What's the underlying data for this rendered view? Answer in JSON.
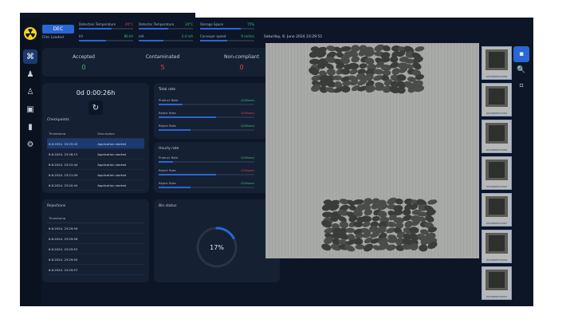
{
  "header": {
    "dec_label": "DEC",
    "film_status": "Film Loaded",
    "metrics": [
      {
        "label": "Detection Temperature",
        "value": "40°C",
        "fill": 0.6,
        "alert": true
      },
      {
        "label": "Detector Temperature",
        "value": "24°C",
        "fill": 0.55,
        "alert": false
      },
      {
        "label": "Storage Space",
        "value": "75%",
        "fill": 0.75,
        "alert": false
      },
      {
        "label": "kV",
        "value": "80 kV",
        "fill": 0.5,
        "alert": false
      },
      {
        "label": "mA",
        "value": "2.4 mA",
        "fill": 0.45,
        "alert": false
      },
      {
        "label": "Conveyor speed",
        "value": "9 m/min",
        "fill": 0.5,
        "alert": false
      }
    ]
  },
  "sidebar": {
    "items": [
      {
        "name": "sidebar-item-scan",
        "icon": "scan-icon",
        "glyph": "⌘",
        "active": true
      },
      {
        "name": "sidebar-item-user",
        "icon": "user-icon",
        "glyph": "♟",
        "active": false
      },
      {
        "name": "sidebar-item-users",
        "icon": "users-icon",
        "glyph": "♙",
        "active": false
      },
      {
        "name": "sidebar-item-package",
        "icon": "package-icon",
        "glyph": "▣",
        "active": false
      },
      {
        "name": "sidebar-item-reports",
        "icon": "bar-chart-icon",
        "glyph": "▮",
        "active": false
      },
      {
        "name": "sidebar-item-settings",
        "icon": "gear-icon",
        "glyph": "⚙",
        "active": false
      }
    ]
  },
  "stats": [
    {
      "label": "Accepted",
      "value": "0",
      "color": "#38c172"
    },
    {
      "label": "Contaminated",
      "value": "5",
      "color": "#e0454a"
    },
    {
      "label": "Non-compliant",
      "value": "0",
      "color": "#e0454a"
    }
  ],
  "timer": {
    "elapsed": "0d 0:00:26h"
  },
  "checkpoints": {
    "title": "Checkpoints",
    "columns": [
      "Timestamp",
      "Description"
    ],
    "rows": [
      [
        "6.6.2024. 23:29:43",
        "Application started"
      ],
      [
        "6.6.2024. 23:26:13",
        "Application started"
      ],
      [
        "6.6.2024. 23:22:44",
        "Application started"
      ],
      [
        "6.6.2024. 23:21:09",
        "Application started"
      ],
      [
        "6.6.2024. 23:20:44",
        "Application started"
      ]
    ]
  },
  "total_rate": {
    "title": "Total rate",
    "rows": [
      {
        "label": "Product Rate",
        "value": "0/26secs",
        "fill": 0.25,
        "color": "#38c172"
      },
      {
        "label": "Reject Rate",
        "value": "5/26secs",
        "fill": 0.6,
        "color": "#e0454a"
      },
      {
        "label": "Reject Rate",
        "value": "0/26secs",
        "fill": 0.33,
        "color": "#38c172"
      }
    ]
  },
  "hourly_rate": {
    "title": "Hourly rate",
    "rows": [
      {
        "label": "Product Rate",
        "value": "0/26secs",
        "fill": 0.15,
        "color": "#38c172"
      },
      {
        "label": "Reject Rate",
        "value": "5/26secs",
        "fill": 0.6,
        "color": "#e0454a"
      },
      {
        "label": "Reject Rate",
        "value": "0/26secs",
        "fill": 0.33,
        "color": "#38c172"
      }
    ]
  },
  "rejections": {
    "title": "Rejections",
    "columns": [
      "Timestamp"
    ],
    "rows": [
      "6.6.2024. 23:29:59",
      "6.6.2024. 23:29:56",
      "6.6.2024. 23:29:53",
      "6.6.2024. 23:29:50",
      "6.6.2024. 23:29:57"
    ]
  },
  "bin_status": {
    "title": "Bin status",
    "percent": 17,
    "label": "17%"
  },
  "image_panel": {
    "date": "Saturday, 8. June 2024 23:29:51"
  },
  "thumbnails": [
    "20240608T232956",
    "20240608T232953",
    "20240608T232950",
    "20240608T232947",
    "20240608T232927",
    "20240608T194024",
    "20240608T194013"
  ],
  "tools": [
    {
      "name": "save-tool-button",
      "icon": "save-icon",
      "glyph": "▪",
      "active": true
    },
    {
      "name": "zoom-tool-button",
      "icon": "zoom-icon",
      "glyph": "🔍",
      "active": false
    },
    {
      "name": "crop-tool-button",
      "icon": "crop-icon",
      "glyph": "⌗",
      "active": false
    }
  ],
  "colors": {
    "accent": "#2a66d4",
    "ok": "#38c172",
    "alert": "#e0454a",
    "logo": "#f2d321"
  }
}
